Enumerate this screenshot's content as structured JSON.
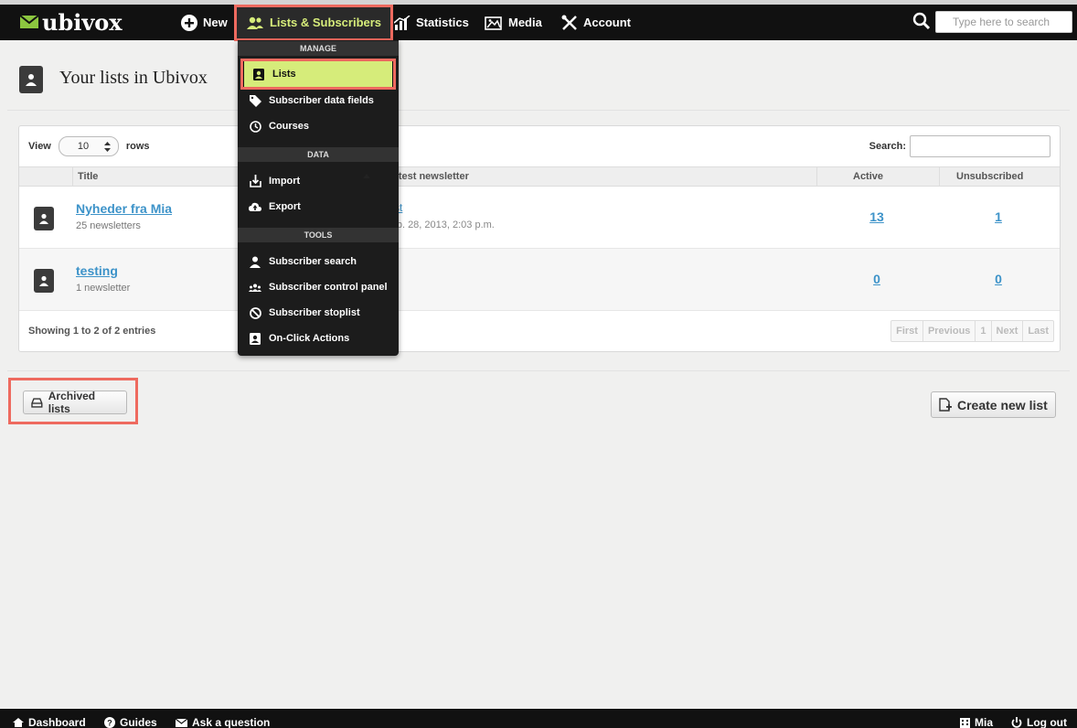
{
  "logo": {
    "text": "ubivox"
  },
  "nav": {
    "new": "New",
    "lists": "Lists & Subscribers",
    "statistics": "Statistics",
    "media": "Media",
    "account": "Account",
    "search_placeholder": "Type here to search"
  },
  "dropdown": {
    "manage_header": "MANAGE",
    "lists": "Lists",
    "subscriber_data_fields": "Subscriber data fields",
    "courses": "Courses",
    "data_header": "DATA",
    "import": "Import",
    "export": "Export",
    "tools_header": "TOOLS",
    "subscriber_search": "Subscriber search",
    "subscriber_control_panel": "Subscriber control panel",
    "subscriber_stoplist": "Subscriber stoplist",
    "on_click_actions": "On-Click Actions"
  },
  "page": {
    "title": "Your lists in Ubivox"
  },
  "table": {
    "view_label": "View",
    "rows_value": "10",
    "rows_label": "rows",
    "search_label": "Search:",
    "columns": {
      "title": "Title",
      "latest": "Latest newsletter",
      "active": "Active",
      "unsubscribed": "Unsubscribed"
    },
    "rows": [
      {
        "title": "Nyheder fra Mia",
        "sub": "25 newsletters",
        "latest_link": "test",
        "latest_date": "Feb. 28, 2013, 2:03 p.m.",
        "active": "13",
        "unsubscribed": "1"
      },
      {
        "title": "testing",
        "sub": "1 newsletter",
        "latest_link": "",
        "latest_date": "",
        "active": "0",
        "unsubscribed": "0"
      }
    ],
    "showing": "Showing 1 to 2 of 2 entries",
    "pager": {
      "first": "First",
      "previous": "Previous",
      "page": "1",
      "next": "Next",
      "last": "Last"
    }
  },
  "buttons": {
    "archived": "Archived lists",
    "create": "Create new list"
  },
  "footer": {
    "dashboard": "Dashboard",
    "guides": "Guides",
    "ask": "Ask a question",
    "user": "Mia",
    "logout": "Log out"
  },
  "colors": {
    "accent": "#d6ec7a",
    "highlight": "#ee6a5f",
    "link": "#3d93c9",
    "navbar": "#111111"
  }
}
